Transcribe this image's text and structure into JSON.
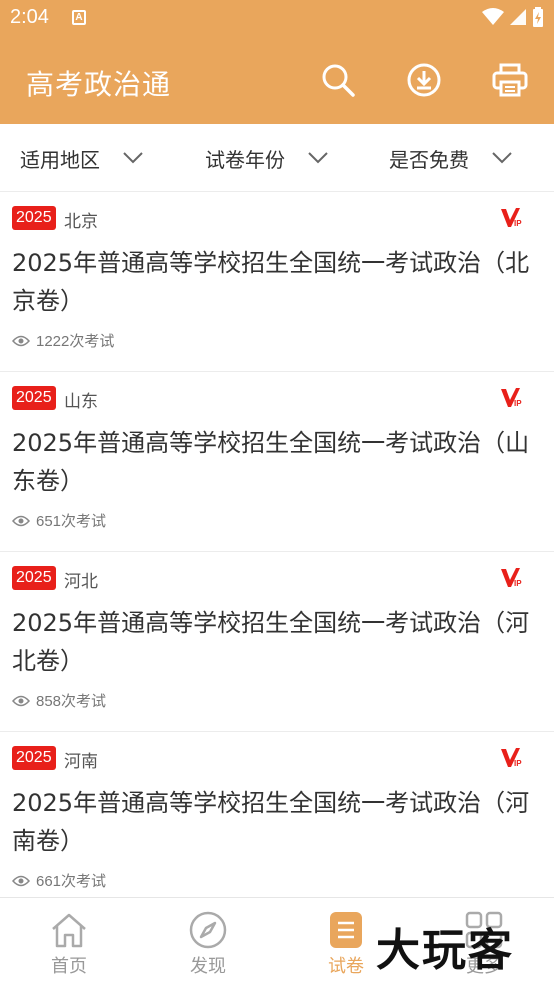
{
  "status_bar": {
    "time": "2:04"
  },
  "app_bar": {
    "title": "高考政治通"
  },
  "filters": [
    {
      "label": "适用地区"
    },
    {
      "label": "试卷年份"
    },
    {
      "label": "是否免费"
    }
  ],
  "papers": [
    {
      "year": "2025",
      "region": "北京",
      "title": "2025年普通高等学校招生全国统一考试政治（北京卷）",
      "views": "1222次考试"
    },
    {
      "year": "2025",
      "region": "山东",
      "title": "2025年普通高等学校招生全国统一考试政治（山东卷）",
      "views": "651次考试"
    },
    {
      "year": "2025",
      "region": "河北",
      "title": "2025年普通高等学校招生全国统一考试政治（河北卷）",
      "views": "858次考试"
    },
    {
      "year": "2025",
      "region": "河南",
      "title": "2025年普通高等学校招生全国统一考试政治（河南卷）",
      "views": "661次考试"
    }
  ],
  "tabs": [
    {
      "label": "首页",
      "icon": "home-icon"
    },
    {
      "label": "发现",
      "icon": "compass-icon"
    },
    {
      "label": "试卷",
      "icon": "document-icon",
      "active": true
    },
    {
      "label": "更多",
      "icon": "grid-icon"
    }
  ],
  "watermark": "大玩客",
  "colors": {
    "primary": "#e9a65c",
    "badge": "#e8201a"
  }
}
